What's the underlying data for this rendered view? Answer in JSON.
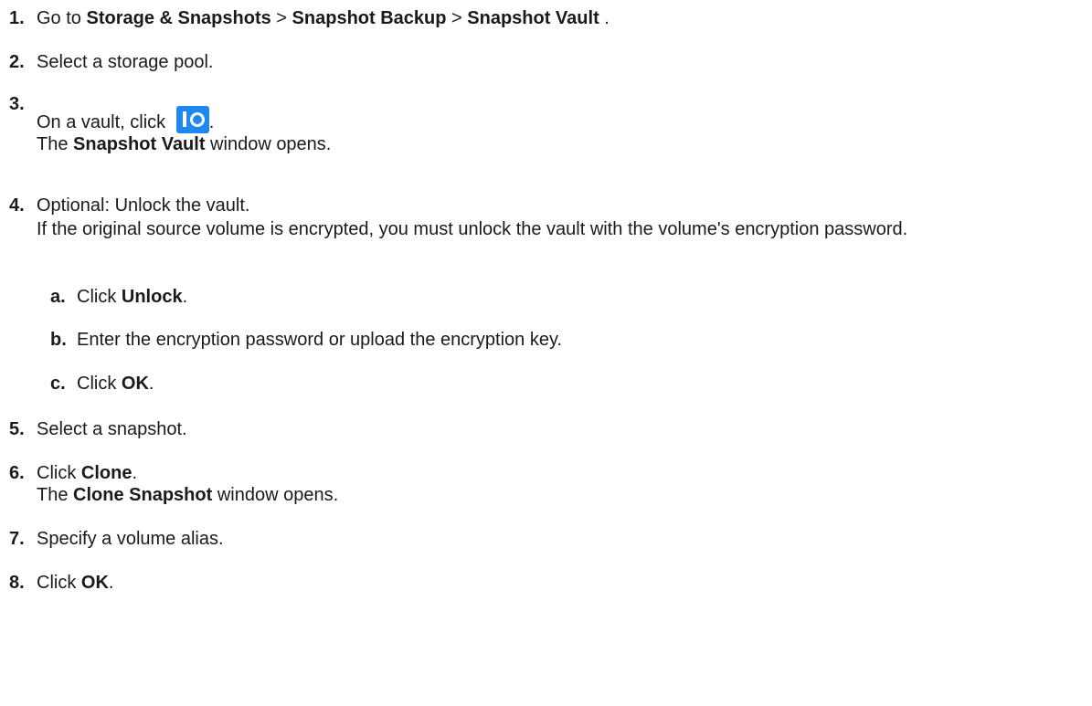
{
  "steps": {
    "s1": {
      "num": "1.",
      "t1": "Go to ",
      "b1": "Storage & Snapshots",
      "t2": " > ",
      "b2": "Snapshot Backup",
      "t3": " > ",
      "b3": "Snapshot Vault",
      "t4": " ."
    },
    "s2": {
      "num": "2.",
      "t1": "Select a storage pool."
    },
    "s3": {
      "num": "3.",
      "t1": "On a vault, click ",
      "icon": "vault-icon",
      "t2": ".",
      "r1": "The ",
      "rb": "Snapshot Vault",
      "r2": " window opens."
    },
    "s4": {
      "num": "4.",
      "t1": "Optional: Unlock the vault.",
      "r1": "If the original source volume is encrypted, you must unlock the vault with the volume's encryption password.",
      "a": {
        "num": "a.",
        "t1": "Click ",
        "b1": "Unlock",
        "t2": "."
      },
      "b": {
        "num": "b.",
        "t1": "Enter the encryption password or upload the encryption key."
      },
      "c": {
        "num": "c.",
        "t1": "Click ",
        "b1": "OK",
        "t2": "."
      }
    },
    "s5": {
      "num": "5.",
      "t1": "Select a snapshot."
    },
    "s6": {
      "num": "6.",
      "t1": "Click ",
      "b1": "Clone",
      "t2": ".",
      "r1": "The ",
      "rb": "Clone Snapshot",
      "r2": " window opens."
    },
    "s7": {
      "num": "7.",
      "t1": "Specify a volume alias."
    },
    "s8": {
      "num": "8.",
      "t1": "Click ",
      "b1": "OK",
      "t2": "."
    }
  },
  "colors": {
    "icon_bg": "#1e88f0",
    "text": "#1a1a1a"
  }
}
